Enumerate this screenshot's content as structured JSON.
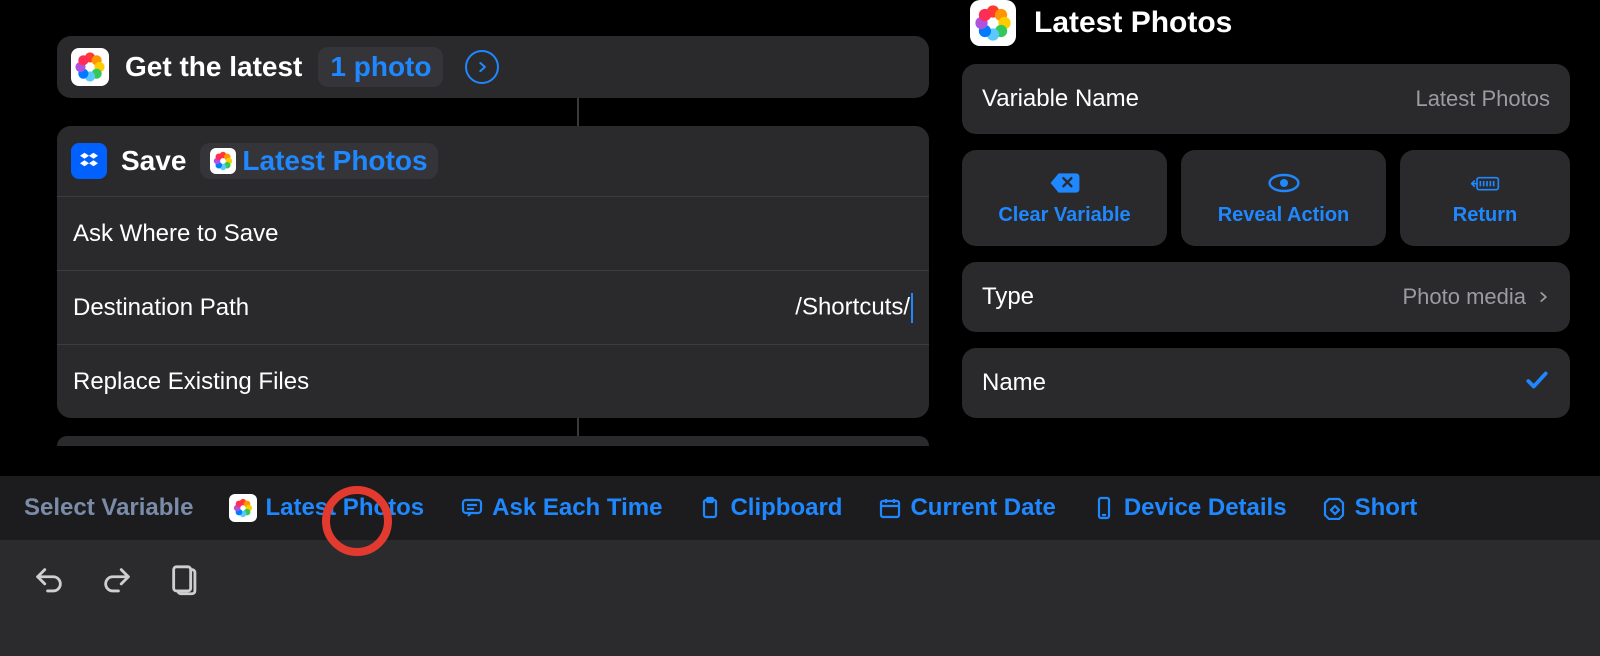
{
  "action_get": {
    "prefix": "Get the latest",
    "count_label": "1 photo"
  },
  "action_save": {
    "verb": "Save",
    "token": "Latest Photos",
    "rows": {
      "ask_where": "Ask Where to Save",
      "dest_label": "Destination Path",
      "dest_value": "/Shortcuts/",
      "replace": "Replace Existing Files"
    }
  },
  "panel": {
    "title": "Latest Photos",
    "varname_label": "Variable Name",
    "varname_value": "Latest Photos",
    "buttons": {
      "clear": "Clear Variable",
      "reveal": "Reveal Action",
      "return": "Return"
    },
    "type_label": "Type",
    "type_value": "Photo media",
    "name_label": "Name"
  },
  "varbar": {
    "select": "Select Variable",
    "latest": "Latest Photos",
    "ask": "Ask Each Time",
    "clipboard": "Clipboard",
    "date": "Current Date",
    "device": "Device Details",
    "short": "Short"
  }
}
